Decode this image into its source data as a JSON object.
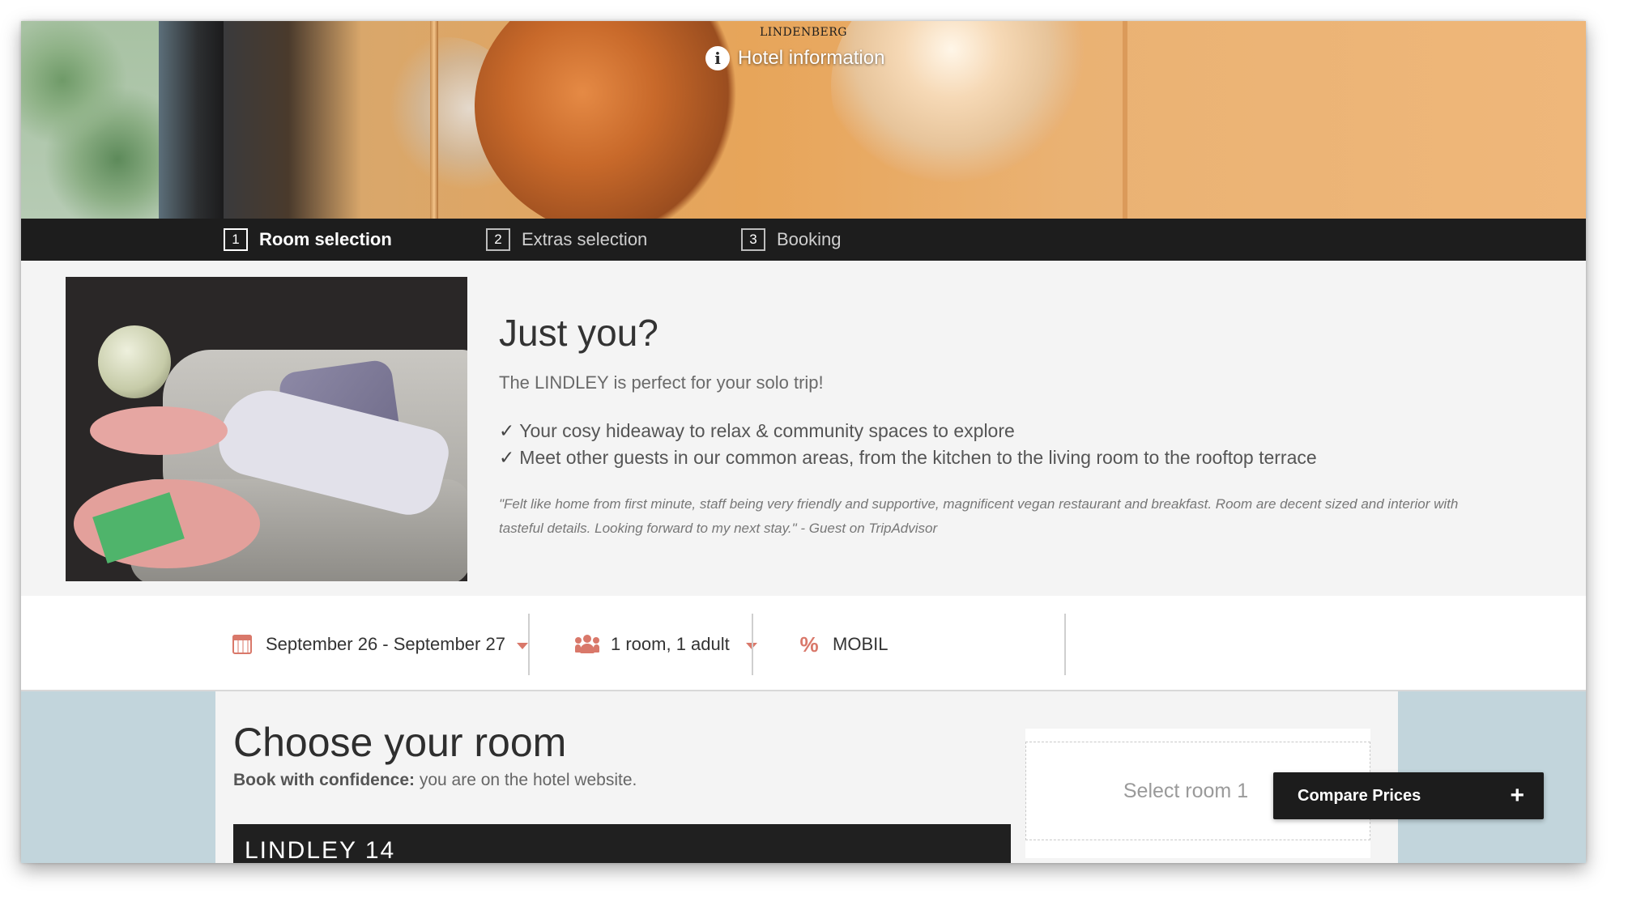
{
  "hero": {
    "brand": "LINDENBERG",
    "hotel_info_label": "Hotel information"
  },
  "steps": [
    {
      "number": "1",
      "label": "Room selection",
      "active": true
    },
    {
      "number": "2",
      "label": "Extras selection",
      "active": false
    },
    {
      "number": "3",
      "label": "Booking",
      "active": false
    }
  ],
  "promo": {
    "title": "Just you?",
    "subtitle": "The LINDLEY is perfect for your solo trip!",
    "check_glyph": "✓",
    "bullets": [
      "Your cosy hideaway to relax & community spaces to explore",
      "Meet other guests in our common areas, from the kitchen to the living room to the rooftop terrace"
    ],
    "quote": "\"Felt like home from first minute, staff being very friendly and supportive, magnificent vegan restaurant and breakfast. Room are decent sized and interior with tasteful details. Looking forward to my next stay.\" - Guest on TripAdvisor"
  },
  "search": {
    "dates": "September 26 - September 27",
    "guests": "1 room, 1 adult",
    "promo_symbol": "%",
    "promo_code": "MOBIL"
  },
  "main": {
    "title": "Choose your room",
    "confidence_bold": "Book with confidence:",
    "confidence_text": " you are on the hotel website.",
    "room_header": "LINDLEY 14",
    "select_room": "Select room 1"
  },
  "compare": {
    "label": "Compare Prices",
    "icon": "+"
  },
  "colors": {
    "accent": "#d9786a",
    "dark_bar": "#1d1d1d",
    "panel_bg": "#f4f4f4",
    "side_bg": "#c2d5dc"
  }
}
